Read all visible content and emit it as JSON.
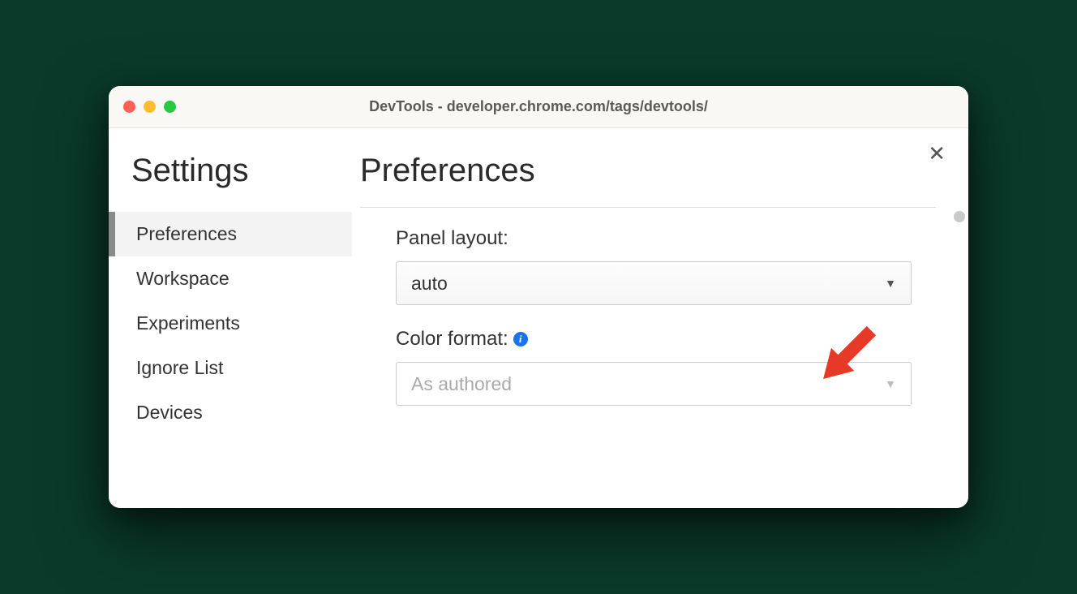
{
  "window": {
    "title": "DevTools - developer.chrome.com/tags/devtools/"
  },
  "sidebar": {
    "heading": "Settings",
    "items": [
      {
        "label": "Preferences",
        "active": true
      },
      {
        "label": "Workspace",
        "active": false
      },
      {
        "label": "Experiments",
        "active": false
      },
      {
        "label": "Ignore List",
        "active": false
      },
      {
        "label": "Devices",
        "active": false
      }
    ]
  },
  "main": {
    "heading": "Preferences",
    "panel_layout_label": "Panel layout:",
    "panel_layout_value": "auto",
    "color_format_label": "Color format:",
    "color_format_value": "As authored",
    "info_glyph": "i"
  },
  "colors": {
    "info_badge": "#1a73e8",
    "arrow": "#e73927"
  }
}
